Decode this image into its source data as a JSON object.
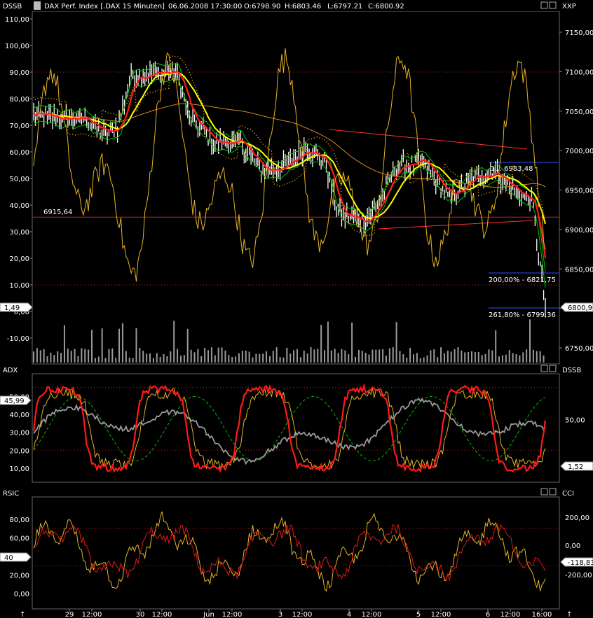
{
  "header": {
    "left_label": "DSSB",
    "title": "DAX Perf. Index [.DAX  15 Minuten]",
    "datetime": "06.06.2008 17:30:00",
    "open": "O:6798.90",
    "high": "H:6803.46",
    "low": "L:6797.21",
    "close": "C:6800.92",
    "right_label": "XXP"
  },
  "colors": {
    "price": "#ffffff",
    "red_line": "#ff1a1a",
    "yellow_line": "#ffff00",
    "green_line": "#00c000",
    "orange_line": "#ffb000",
    "oscillator": "#e6b422",
    "adx_grey": "#9a9a9a",
    "grid": "#ff3030",
    "blue_level": "#2b4dff"
  },
  "panels": {
    "price": {
      "left_ticks": [
        "110,00",
        "100,00",
        "90,00",
        "80,00",
        "70,00",
        "60,00",
        "50,00",
        "40,00",
        "30,00",
        "20,00",
        "10,00",
        "0,00",
        "-10,00"
      ],
      "right_ticks": [
        "7150,00",
        "7100,00",
        "7050,00",
        "7000,00",
        "6950,00",
        "6900,00",
        "6850,00",
        "6800,00",
        "6750,00"
      ],
      "horizontal_line_label": "6915,64",
      "fib_labels": [
        "1... 6983,48",
        "200,00% - 6821,75",
        "261,80% - 6799,36"
      ],
      "left_marker": "1,49",
      "right_marker": "6800,9"
    },
    "adx": {
      "left_label": "ADX",
      "right_label": "DSSB",
      "left_ticks": [
        "50,00",
        "40,00",
        "30,00",
        "20,00",
        "10,00"
      ],
      "right_ticks": [
        "50,00"
      ],
      "left_marker": "45,99",
      "right_marker": "1,52"
    },
    "rsic": {
      "left_label": "RSIC",
      "right_label": "CCI",
      "left_ticks": [
        "80,00",
        "60,00",
        "40,00",
        "20,00",
        "0,00"
      ],
      "right_ticks": [
        "200,00",
        "0,00",
        "-200,00"
      ],
      "left_marker": "40",
      "right_marker": "-118,83"
    },
    "xaxis": {
      "labels": [
        "29",
        "12:00",
        "30",
        "12:00",
        "Jun",
        "12:00",
        "3",
        "12:00",
        "4",
        "12:00",
        "5",
        "12:00",
        "6",
        "12:00",
        "16:00"
      ]
    }
  },
  "chart_data": {
    "type": "line",
    "x": [
      "29",
      "12:00",
      "30",
      "12:00",
      "Jun",
      "12:00",
      "3",
      "12:00",
      "4",
      "12:00",
      "5",
      "12:00",
      "6",
      "12:00",
      "16:00"
    ],
    "price_close_right_axis": [
      7040,
      7045,
      7035,
      7055,
      7090,
      7100,
      7050,
      7020,
      7000,
      6985,
      7005,
      6925,
      6920,
      6960,
      6975,
      6955,
      6940,
      6800
    ],
    "ylim_left": [
      -15,
      112
    ],
    "ylim_right": [
      6735,
      7180
    ],
    "horizontal_line": 6915.64,
    "series": []
  }
}
